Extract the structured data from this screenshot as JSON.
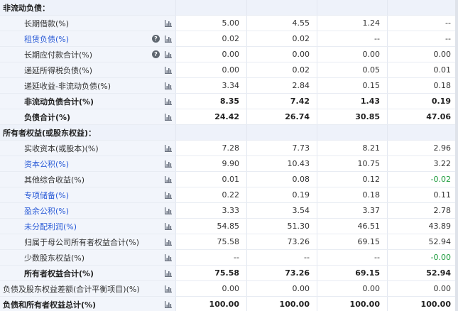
{
  "colors": {
    "link": "#2a5bd7",
    "negative": "#1a9a3a",
    "section_bg": "#eef2fa"
  },
  "rows": [
    {
      "label": "非流动负债：",
      "type": "section",
      "values": [
        "",
        "",
        "",
        ""
      ]
    },
    {
      "label": "长期借款(%)",
      "type": "item",
      "values": [
        "5.00",
        "4.55",
        "1.24",
        "--"
      ]
    },
    {
      "label": "租赁负债(%)",
      "type": "item",
      "link": true,
      "help": true,
      "values": [
        "0.02",
        "0.02",
        "--",
        "--"
      ]
    },
    {
      "label": "长期应付款合计(%)",
      "type": "item",
      "help": true,
      "values": [
        "0.00",
        "0.00",
        "0.00",
        "0.00"
      ]
    },
    {
      "label": "递延所得税负债(%)",
      "type": "item",
      "values": [
        "0.00",
        "0.02",
        "0.05",
        "0.01"
      ]
    },
    {
      "label": "递延收益-非流动负债(%)",
      "type": "item",
      "values": [
        "3.34",
        "2.84",
        "0.15",
        "0.18"
      ]
    },
    {
      "label": "非流动负债合计(%)",
      "type": "total",
      "values": [
        "8.35",
        "7.42",
        "1.43",
        "0.19"
      ]
    },
    {
      "label": "负债合计(%)",
      "type": "total",
      "values": [
        "24.42",
        "26.74",
        "30.85",
        "47.06"
      ]
    },
    {
      "label": "所有者权益(或股东权益)：",
      "type": "section",
      "values": [
        "",
        "",
        "",
        ""
      ]
    },
    {
      "label": "实收资本(或股本)(%)",
      "type": "item",
      "values": [
        "7.28",
        "7.73",
        "8.21",
        "2.96"
      ]
    },
    {
      "label": "资本公积(%)",
      "type": "item",
      "link": true,
      "values": [
        "9.90",
        "10.43",
        "10.75",
        "3.22"
      ]
    },
    {
      "label": "其他综合收益(%)",
      "type": "item",
      "values": [
        "0.01",
        "0.08",
        "0.12",
        "-0.02"
      ]
    },
    {
      "label": "专项储备(%)",
      "type": "item",
      "link": true,
      "values": [
        "0.22",
        "0.19",
        "0.18",
        "0.11"
      ]
    },
    {
      "label": "盈余公积(%)",
      "type": "item",
      "link": true,
      "values": [
        "3.33",
        "3.54",
        "3.37",
        "2.78"
      ]
    },
    {
      "label": "未分配利润(%)",
      "type": "item",
      "link": true,
      "values": [
        "54.85",
        "51.30",
        "46.51",
        "43.89"
      ]
    },
    {
      "label": "归属于母公司所有者权益合计(%)",
      "type": "item",
      "values": [
        "75.58",
        "73.26",
        "69.15",
        "52.94"
      ]
    },
    {
      "label": "少数股东权益(%)",
      "type": "item",
      "values": [
        "--",
        "--",
        "--",
        "-0.00"
      ]
    },
    {
      "label": "所有者权益合计(%)",
      "type": "total",
      "values": [
        "75.58",
        "73.26",
        "69.15",
        "52.94"
      ]
    },
    {
      "label": "负债及股东权益差额(合计平衡项目)(%)",
      "type": "item",
      "flush": true,
      "values": [
        "0.00",
        "0.00",
        "0.00",
        "0.00"
      ]
    },
    {
      "label": "负债和所有者权益总计(%)",
      "type": "total",
      "flush": true,
      "values": [
        "100.00",
        "100.00",
        "100.00",
        "100.00"
      ]
    }
  ]
}
